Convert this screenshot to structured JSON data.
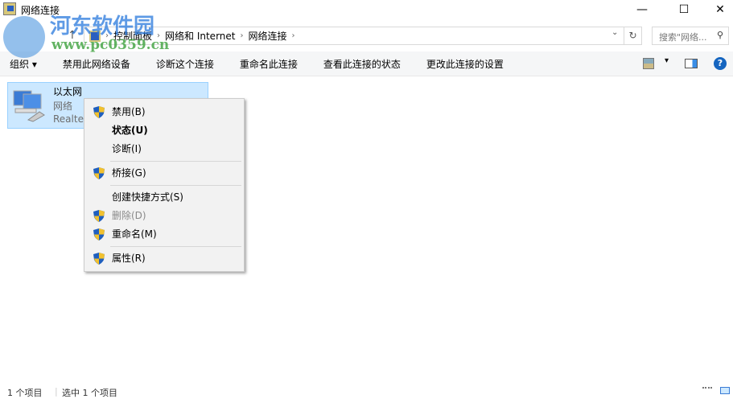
{
  "window": {
    "title": "网络连接",
    "minimize": "—",
    "maximize": "☐",
    "close": "✕"
  },
  "address": {
    "up": "↑",
    "crumbs": [
      "控制面板",
      "网络和 Internet",
      "网络连接"
    ],
    "sep": "›",
    "dropdown": "⌄",
    "refresh": "↻",
    "search_placeholder": "搜索\"网络...",
    "search_icon": "⚲"
  },
  "toolbar": {
    "items": [
      "组织 ▾",
      "禁用此网络设备",
      "诊断这个连接",
      "重命名此连接",
      "查看此连接的状态",
      "更改此连接的设置"
    ],
    "view_dropdown": "▾",
    "help": "?"
  },
  "item": {
    "name": "以太网",
    "network": "网络",
    "adapter": "Realtek"
  },
  "context_menu": {
    "items": [
      {
        "label": "禁用(B)",
        "shield": true
      },
      {
        "label": "状态(U)",
        "bold": true
      },
      {
        "label": "诊断(I)"
      },
      {
        "label": "桥接(G)",
        "shield": true
      },
      {
        "label": "创建快捷方式(S)"
      },
      {
        "label": "删除(D)",
        "shield": true,
        "disabled": true
      },
      {
        "label": "重命名(M)",
        "shield": true
      },
      {
        "label": "属性(R)",
        "shield": true
      }
    ]
  },
  "status": {
    "count": "1 个项目",
    "selected": "选中 1 个项目"
  },
  "watermark": {
    "name": "河东软件园",
    "url": "www.pc0359.cn"
  }
}
